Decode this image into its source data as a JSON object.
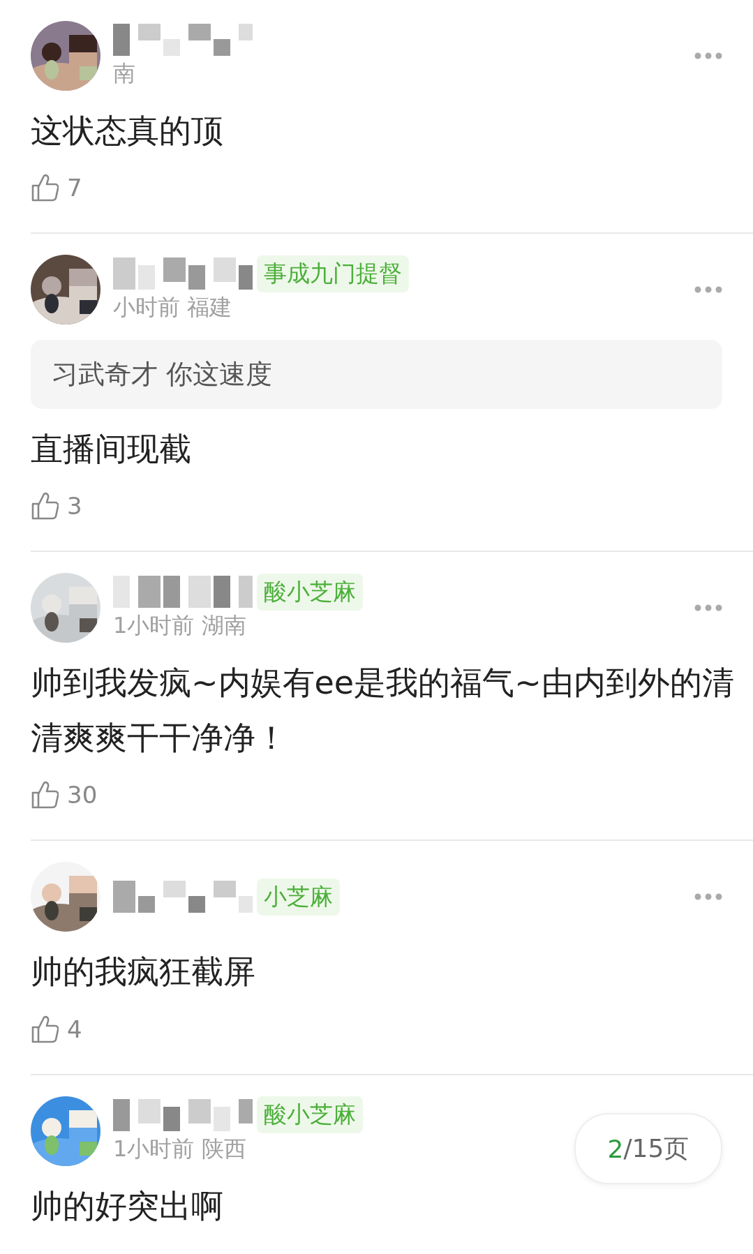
{
  "comments": [
    {
      "meta": "南",
      "text": "这状态真的顶",
      "likes": "7",
      "menu": true
    },
    {
      "badge": "事成九门提督",
      "meta": "小时前 福建",
      "quote": "习武奇才 你这速度",
      "text": "直播间现截",
      "likes": "3",
      "menu": true
    },
    {
      "badge": "酸小芝麻",
      "meta": "1小时前 湖南",
      "text": "帅到我发疯~内娱有ee是我的福气~由内到外的清清爽爽干干净净！",
      "likes": "30",
      "menu": true
    },
    {
      "badge": "小芝麻",
      "text": "帅的我疯狂截屏",
      "likes": "4",
      "menu": true
    },
    {
      "badge": "酸小芝麻",
      "meta": "1小时前 陕西",
      "text": "帅的好突出啊",
      "menu": false
    }
  ],
  "pager": {
    "current": "2",
    "total": "/15页"
  }
}
